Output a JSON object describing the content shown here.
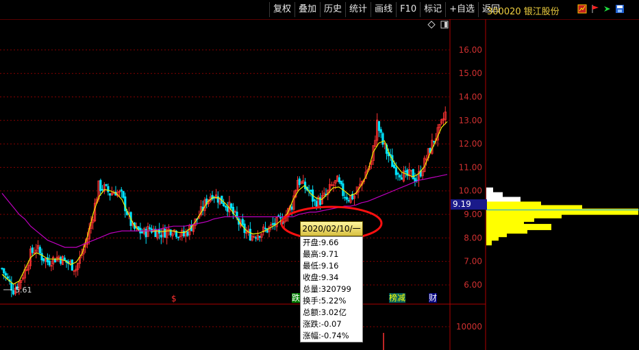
{
  "toolbar": {
    "buttons": [
      "复权",
      "叠加",
      "历史",
      "统计",
      "画线",
      "F10",
      "标记",
      "+自选",
      "返回"
    ]
  },
  "stock": {
    "title": "300020 银江股份"
  },
  "colors": {
    "up": "#ff3333",
    "down": "#00e5ff",
    "ma_short": "#f0f000",
    "ma_long": "#c000c0",
    "grid": "#8a0000",
    "axis_text": "#d03030"
  },
  "icons": [
    "chart-type-icon",
    "flag-red-icon",
    "flag-green-icon",
    "floppy-icon",
    "diamond-icon",
    "layout-icon"
  ],
  "chart_data": {
    "type": "line",
    "description_kind": "candlestick_with_moving_averages",
    "ylim": [
      5.3,
      16.9
    ],
    "y_ticks": [
      "6.00",
      "7.00",
      "8.00",
      "9.00",
      "10.00",
      "11.00",
      "12.00",
      "13.00",
      "14.00",
      "15.00",
      "16.00"
    ],
    "low_label": "5.61",
    "current_price_label": "9.19",
    "volume_tick": "10000",
    "series": [
      {
        "name": "price_approx",
        "values": [
          6.7,
          6.2,
          5.8,
          6.1,
          6.6,
          7.3,
          7.6,
          7.2,
          7.0,
          7.1,
          7.2,
          7.0,
          6.9,
          6.7,
          7.3,
          8.0,
          9.0,
          10.2,
          10.1,
          9.9,
          10.0,
          9.8,
          9.1,
          8.4,
          8.3,
          8.2,
          8.4,
          8.3,
          8.2,
          8.3,
          8.4,
          8.2,
          8.1,
          8.4,
          8.7,
          9.1,
          9.6,
          9.9,
          9.7,
          9.5,
          9.3,
          8.9,
          8.5,
          8.2,
          8.1,
          8.2,
          8.3,
          8.4,
          8.6,
          8.7,
          9.0,
          9.4,
          10.5,
          10.2,
          10.0,
          9.5,
          9.6,
          9.8,
          10.2,
          10.4,
          9.9,
          9.7,
          9.8,
          10.2,
          10.8,
          11.2,
          12.9,
          12.0,
          11.5,
          11.0,
          10.8,
          10.6,
          10.7,
          10.5,
          11.0,
          11.6,
          12.2,
          12.6,
          13.3
        ]
      },
      {
        "name": "ma_long_approx",
        "values": [
          9.9,
          9.6,
          9.3,
          9.0,
          8.8,
          8.5,
          8.3,
          8.1,
          7.9,
          7.8,
          7.7,
          7.6,
          7.6,
          7.6,
          7.7,
          7.8,
          7.9,
          8.0,
          8.1,
          8.2,
          8.25,
          8.3,
          8.3,
          8.3,
          8.3,
          8.3,
          8.3,
          8.35,
          8.4,
          8.45,
          8.5,
          8.5,
          8.5,
          8.55,
          8.6,
          8.65,
          8.7,
          8.8,
          8.85,
          8.9,
          8.9,
          8.9,
          8.9,
          8.9,
          8.9,
          8.9,
          8.9,
          8.9,
          8.9,
          8.9,
          8.9,
          8.9,
          9.0,
          9.05,
          9.1,
          9.1,
          9.15,
          9.2,
          9.25,
          9.3,
          9.35,
          9.35,
          9.4,
          9.5,
          9.55,
          9.65,
          9.75,
          9.85,
          9.95,
          10.05,
          10.15,
          10.25,
          10.35,
          10.45,
          10.5,
          10.55,
          10.6,
          10.65,
          10.7
        ]
      }
    ],
    "volume_profile": [
      {
        "price": 10.0,
        "width": 10
      },
      {
        "price": 9.8,
        "width": 24
      },
      {
        "price": 9.6,
        "width": 50
      },
      {
        "price": 9.4,
        "width": 80
      },
      {
        "price": 9.25,
        "width": 140
      },
      {
        "price": 9.1,
        "width": 222
      },
      {
        "price": 8.95,
        "width": 110
      },
      {
        "price": 8.8,
        "width": 70
      },
      {
        "price": 8.6,
        "width": 55
      },
      {
        "price": 8.45,
        "width": 95
      },
      {
        "price": 8.3,
        "width": 60
      },
      {
        "price": 8.15,
        "width": 30
      },
      {
        "price": 8.0,
        "width": 18
      },
      {
        "price": 7.8,
        "width": 8
      }
    ],
    "tooltip": {
      "date": "2020/02/10/一",
      "rows": [
        "开盘:9.66",
        "最高:9.71",
        "最低:9.16",
        "收盘:9.34",
        "总量:320799",
        "换手:5.22%",
        "总额:3.02亿",
        "涨跌:-0.07",
        "涨幅:-0.74%"
      ]
    },
    "markers": [
      {
        "label": "$",
        "color": "#ff3030"
      },
      {
        "label": "跌",
        "color": "#ffffff",
        "bg": "#008000"
      },
      {
        "label": "榜减",
        "color": "#ffff00",
        "bg": "#006060"
      },
      {
        "label": "财",
        "color": "#ffffff",
        "bg": "#000080"
      }
    ]
  }
}
